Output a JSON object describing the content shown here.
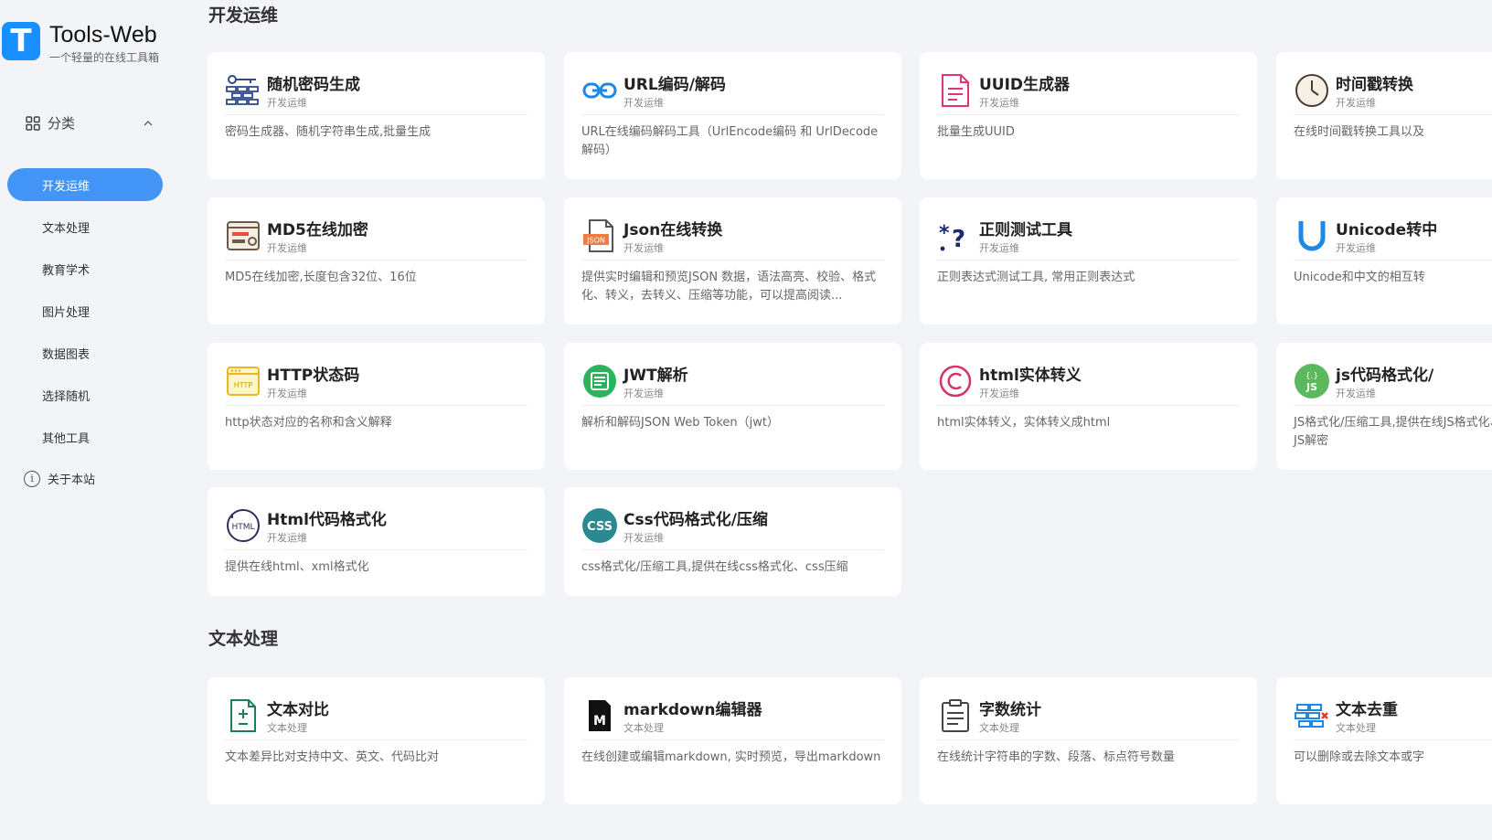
{
  "app": {
    "title": "Tools-Web",
    "subtitle": "一个轻量的在线工具箱",
    "logo_letter": "T",
    "accent": "#4294f7"
  },
  "sidebar": {
    "category_label": "分类",
    "items": [
      {
        "label": "开发运维",
        "active": true
      },
      {
        "label": "文本处理"
      },
      {
        "label": "教育学术"
      },
      {
        "label": "图片处理"
      },
      {
        "label": "数据图表"
      },
      {
        "label": "选择随机"
      },
      {
        "label": "其他工具"
      }
    ],
    "about_label": "关于本站"
  },
  "sections": [
    {
      "title": "开发运维",
      "cards": [
        {
          "title": "随机密码生成",
          "tag": "开发运维",
          "desc": "密码生成器、随机字符串生成,批量生成",
          "icon": "password-icon"
        },
        {
          "title": "URL编码/解码",
          "tag": "开发运维",
          "desc": "URL在线编码解码工具（UrlEncode编码 和 UrlDecode解码）",
          "icon": "link-icon"
        },
        {
          "title": "UUID生成器",
          "tag": "开发运维",
          "desc": "批量生成UUID",
          "icon": "document-icon"
        },
        {
          "title": "时间戳转换",
          "tag": "开发运维",
          "desc": "在线时间戳转换工具以及",
          "icon": "clock-icon"
        },
        {
          "title": "MD5在线加密",
          "tag": "开发运维",
          "desc": "MD5在线加密,长度包含32位、16位",
          "icon": "md5-icon"
        },
        {
          "title": "Json在线转换",
          "tag": "开发运维",
          "desc": "提供实时编辑和预览JSON 数据，语法高亮、校验、格式化、转义，去转义、压缩等功能，可以提高阅读...",
          "icon": "json-file-icon"
        },
        {
          "title": "正则测试工具",
          "tag": "开发运维",
          "desc": "正则表达式测试工具, 常用正则表达式",
          "icon": "regex-icon"
        },
        {
          "title": "Unicode转中",
          "tag": "开发运维",
          "desc": "Unicode和中文的相互转",
          "icon": "unicode-icon"
        },
        {
          "title": "HTTP状态码",
          "tag": "开发运维",
          "desc": "http状态对应的名称和含义解释",
          "icon": "http-icon"
        },
        {
          "title": "JWT解析",
          "tag": "开发运维",
          "desc": "解析和解码JSON Web Token（jwt）",
          "icon": "jwt-icon"
        },
        {
          "title": "html实体转义",
          "tag": "开发运维",
          "desc": "html实体转义，实体转义成html",
          "icon": "copyright-icon"
        },
        {
          "title": "js代码格式化/",
          "tag": "开发运维",
          "desc": "JS格式化/压缩工具,提供在线JS格式化、JS压缩、JS混淆、JS解密",
          "icon": "js-icon"
        },
        {
          "title": "Html代码格式化",
          "tag": "开发运维",
          "desc": "提供在线html、xml格式化",
          "icon": "html-icon"
        },
        {
          "title": "Css代码格式化/压缩",
          "tag": "开发运维",
          "desc": "css格式化/压缩工具,提供在线css格式化、css压缩",
          "icon": "css-icon"
        }
      ]
    },
    {
      "title": "文本处理",
      "cards": [
        {
          "title": "文本对比",
          "tag": "文本处理",
          "desc": "文本差异比对支持中文、英文、代码比对",
          "icon": "diff-icon"
        },
        {
          "title": "markdown编辑器",
          "tag": "文本处理",
          "desc": "在线创建或编辑markdown, 实时预览，导出markdown",
          "icon": "markdown-icon"
        },
        {
          "title": "字数统计",
          "tag": "文本处理",
          "desc": "在线统计字符串的字数、段落、标点符号数量",
          "icon": "clipboard-icon"
        },
        {
          "title": "文本去重",
          "tag": "文本处理",
          "desc": "可以删除或去除文本或字",
          "icon": "dedupe-icon"
        }
      ]
    }
  ]
}
